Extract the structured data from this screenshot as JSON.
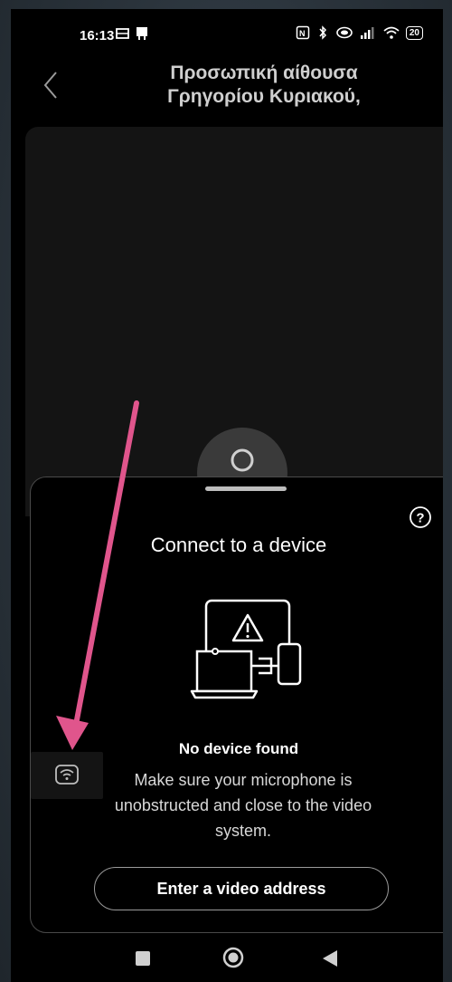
{
  "status_bar": {
    "time": "16:13",
    "battery": "20"
  },
  "header": {
    "title_line1": "Προσωπική αίθουσα",
    "title_line2": "Γρηγορίου Κυριακού,"
  },
  "sheet": {
    "title": "Connect to a device",
    "no_device": "No device found",
    "description": "Make sure your microphone is unobstructed and close to the video system.",
    "button_label": "Enter a video address"
  },
  "icons": {
    "back": "chevron-left-icon",
    "help": "question-circle-icon",
    "illustration": "devices-warning-icon",
    "proximity": "proximity-wifi-icon"
  },
  "colors": {
    "annotation_arrow": "#e0558c",
    "background": "#000000",
    "frame": "#2f3a43"
  }
}
